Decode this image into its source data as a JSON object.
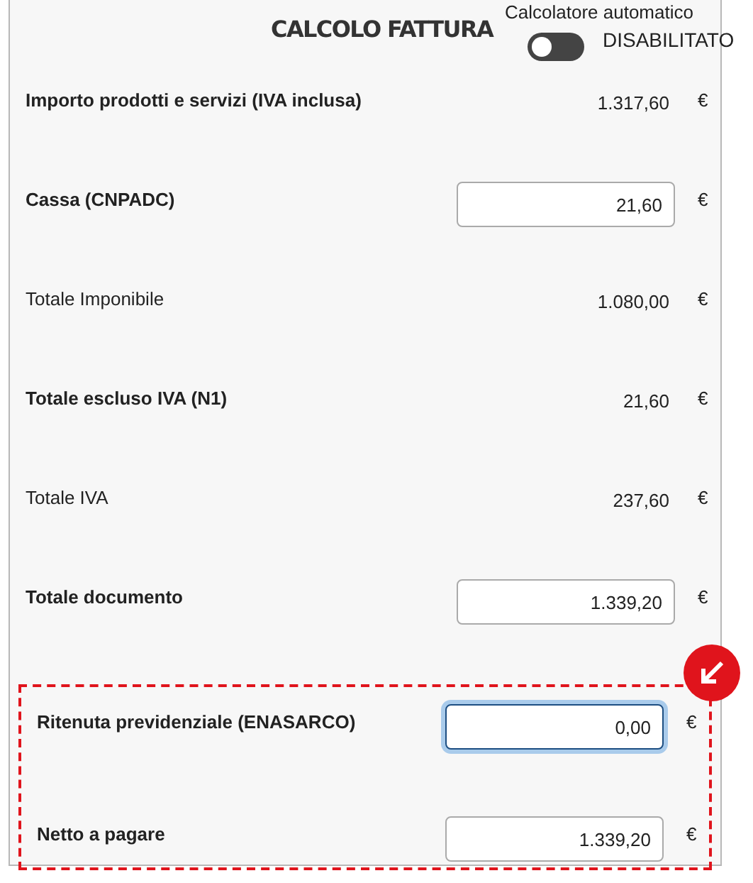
{
  "title": "CALCOLO FATTURA",
  "auto_calculator": {
    "label": "Calcolatore automatico",
    "on": false,
    "status": "DISABILITATO"
  },
  "rows": [
    {
      "label": "Importo prodotti e servizi (IVA inclusa)",
      "bold": true,
      "kind": "value",
      "value": "1.317,60",
      "currency": "€"
    },
    {
      "label": "Cassa (CNPADC)",
      "bold": true,
      "kind": "input",
      "value": "21,60",
      "focused": false,
      "currency": "€"
    },
    {
      "label": "Totale Imponibile",
      "bold": false,
      "kind": "value",
      "value": "1.080,00",
      "currency": "€"
    },
    {
      "label": "Totale escluso IVA (N1)",
      "bold": true,
      "kind": "value",
      "value": "21,60",
      "currency": "€"
    },
    {
      "label": "Totale IVA",
      "bold": false,
      "kind": "value",
      "value": "237,60",
      "currency": "€"
    },
    {
      "label": "Totale documento",
      "bold": true,
      "kind": "input",
      "value": "1.339,20",
      "focused": false,
      "currency": "€"
    }
  ],
  "highlighted_rows": [
    {
      "label": "Ritenuta previdenziale (ENASARCO)",
      "bold": true,
      "kind": "input",
      "value": "0,00",
      "focused": true,
      "currency": "€"
    },
    {
      "label": "Netto a pagare",
      "bold": true,
      "kind": "input",
      "value": "1.339,20",
      "focused": false,
      "currency": "€"
    }
  ]
}
